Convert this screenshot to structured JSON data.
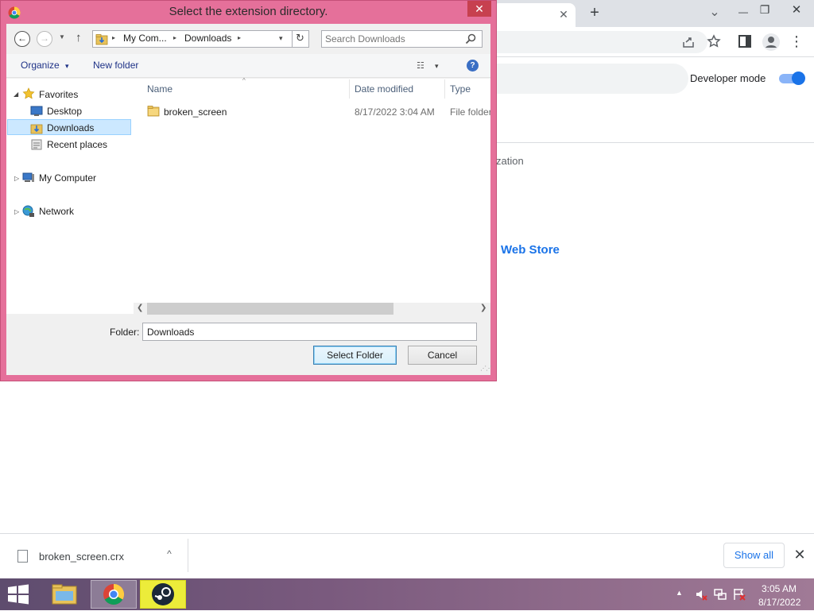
{
  "chrome": {
    "tab_close": "✕",
    "new_tab": "+",
    "window_buttons": {
      "dropdown": "⌄",
      "minimize": "—",
      "restore": "❐",
      "close": "✕"
    },
    "toolbar_icons": [
      "share-icon",
      "star-icon",
      "sidebar-icon",
      "profile-icon",
      "menu-icon"
    ],
    "menu": "⋮",
    "developer_mode_label": "Developer mode",
    "developer_mode_on": true,
    "partial_text_organization": "zation",
    "partial_text_webstore": "Web Store",
    "accent": "#1a73e8"
  },
  "dialog": {
    "title": "Select the extension directory.",
    "close": "✕",
    "nav": {
      "back": "←",
      "forward": "→",
      "recent": "▼",
      "up": "↑"
    },
    "address": {
      "sep": "▸",
      "crumbs": [
        "My Com...",
        "Downloads"
      ],
      "dropdown": "▾",
      "refresh": "↻"
    },
    "search_placeholder": "Search Downloads",
    "organize_label": "Organize",
    "organize_arrow": "▾",
    "new_folder_label": "New folder",
    "view_icon": "☷",
    "view_dropdown": "▾",
    "help": "?",
    "nav_pane": {
      "expanded": "◢",
      "collapsed": "▷",
      "favorites": "Favorites",
      "items": [
        "Desktop",
        "Downloads",
        "Recent places"
      ],
      "selected": "Downloads",
      "my_computer": "My Computer",
      "network": "Network"
    },
    "columns": {
      "name": "Name",
      "date_modified": "Date modified",
      "type": "Type",
      "sort_indicator": "^"
    },
    "files": [
      {
        "name": "broken_screen",
        "date": "8/17/2022 3:04 AM",
        "type": "File folder"
      }
    ],
    "scroll": {
      "left": "❮",
      "right": "❯"
    },
    "folder_label": "Folder:",
    "folder_value": "Downloads",
    "select_button": "Select Folder",
    "cancel_button": "Cancel",
    "frame_color": "#e5709a"
  },
  "download_shelf": {
    "file_name": "broken_screen.crx",
    "chevron": "^",
    "show_all": "Show all",
    "close": "✕"
  },
  "taskbar": {
    "apps": [
      "file-explorer",
      "chrome",
      "steam"
    ],
    "active_app": "chrome",
    "tray_up": "▲",
    "time": "3:05 AM",
    "date": "8/17/2022"
  }
}
